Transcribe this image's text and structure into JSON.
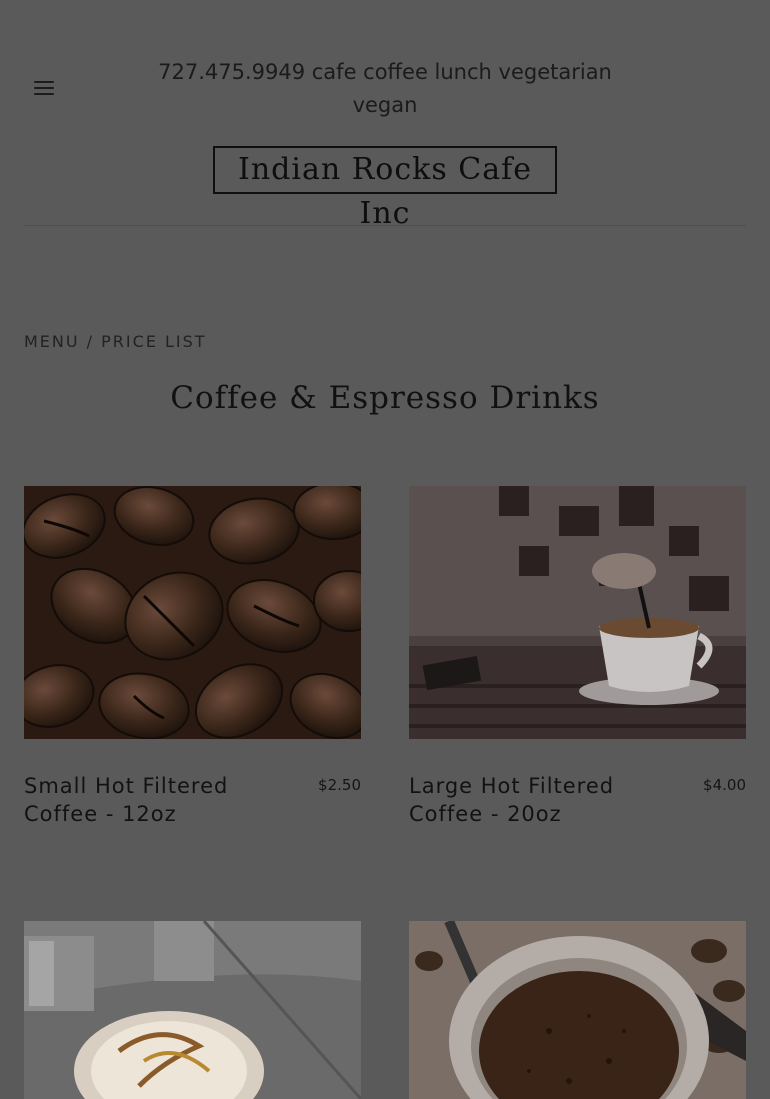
{
  "header": {
    "tagline": "727.475.9949 cafe coffee lunch vegetarian vegan",
    "brand": "Indian Rocks Cafe Inc"
  },
  "breadcrumb": "MENU / PRICE LIST",
  "section_title": "Coffee & Espresso Drinks",
  "items": [
    {
      "name": "Small Hot Filtered Coffee - 12oz",
      "price": "$2.50"
    },
    {
      "name": "Large Hot Filtered Coffee - 20oz",
      "price": "$4.00"
    }
  ],
  "icons": {
    "menu": "hamburger-menu-icon"
  },
  "colors": {
    "overlay_background": "#5a5a5a",
    "text": "#141414"
  }
}
